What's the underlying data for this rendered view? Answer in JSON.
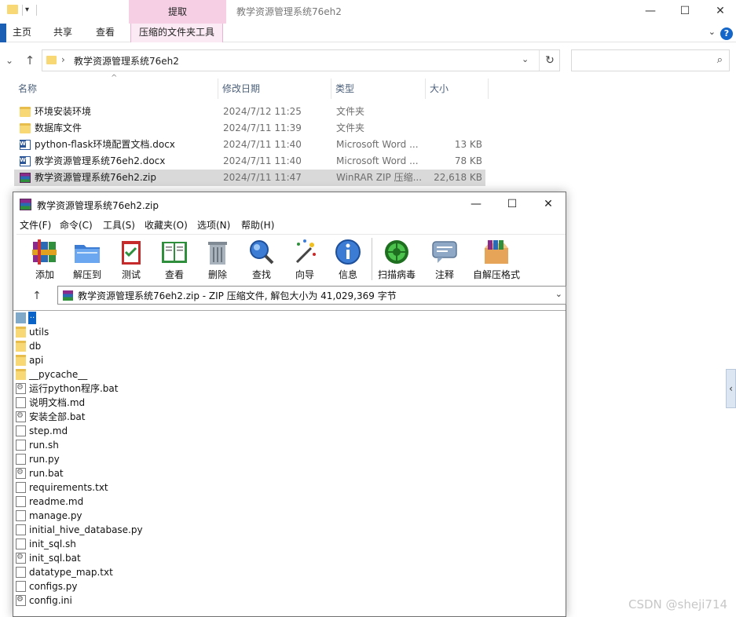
{
  "explorer": {
    "window_title": "教学资源管理系统76eh2",
    "context_tab": "提取",
    "ribbon_tabs": [
      "主页",
      "共享",
      "查看",
      "压缩的文件夹工具"
    ],
    "address": "教学资源管理系统76eh2",
    "columns": {
      "name": "名称",
      "date": "修改日期",
      "type": "类型",
      "size": "大小"
    },
    "files": [
      {
        "name": "环境安装环境",
        "date": "2024/7/12 11:25",
        "type": "文件夹",
        "size": "",
        "icon": "folder"
      },
      {
        "name": "数据库文件",
        "date": "2024/7/11 11:39",
        "type": "文件夹",
        "size": "",
        "icon": "folder"
      },
      {
        "name": "python-flask环境配置文档.docx",
        "date": "2024/7/11 11:40",
        "type": "Microsoft Word ...",
        "size": "13 KB",
        "icon": "word"
      },
      {
        "name": "教学资源管理系统76eh2.docx",
        "date": "2024/7/11 11:40",
        "type": "Microsoft Word ...",
        "size": "78 KB",
        "icon": "word"
      },
      {
        "name": "教学资源管理系统76eh2.zip",
        "date": "2024/7/11 11:47",
        "type": "WinRAR ZIP 压缩...",
        "size": "22,618 KB",
        "icon": "rar"
      }
    ]
  },
  "winrar": {
    "title": "教学资源管理系统76eh2.zip",
    "menu": [
      "文件(F)",
      "命令(C)",
      "工具(S)",
      "收藏夹(O)",
      "选项(N)",
      "帮助(H)"
    ],
    "toolbar": [
      "添加",
      "解压到",
      "测试",
      "查看",
      "删除",
      "查找",
      "向导",
      "信息",
      "扫描病毒",
      "注释",
      "自解压格式"
    ],
    "path_text": "教学资源管理系统76eh2.zip - ZIP 压缩文件, 解包大小为 41,029,369 字节",
    "up_entry": "..",
    "entries": [
      {
        "name": "utils",
        "icon": "folder"
      },
      {
        "name": "db",
        "icon": "folder"
      },
      {
        "name": "api",
        "icon": "folder"
      },
      {
        "name": "__pycache__",
        "icon": "folder"
      },
      {
        "name": "运行python程序.bat",
        "icon": "bat"
      },
      {
        "name": "说明文档.md",
        "icon": "file"
      },
      {
        "name": "安装全部.bat",
        "icon": "bat"
      },
      {
        "name": "step.md",
        "icon": "file"
      },
      {
        "name": "run.sh",
        "icon": "file"
      },
      {
        "name": "run.py",
        "icon": "file"
      },
      {
        "name": "run.bat",
        "icon": "bat"
      },
      {
        "name": "requirements.txt",
        "icon": "file"
      },
      {
        "name": "readme.md",
        "icon": "file"
      },
      {
        "name": "manage.py",
        "icon": "file"
      },
      {
        "name": "initial_hive_database.py",
        "icon": "file"
      },
      {
        "name": "init_sql.sh",
        "icon": "file"
      },
      {
        "name": "init_sql.bat",
        "icon": "bat"
      },
      {
        "name": "datatype_map.txt",
        "icon": "file"
      },
      {
        "name": "configs.py",
        "icon": "file"
      },
      {
        "name": "config.ini",
        "icon": "ini"
      }
    ]
  },
  "watermark": "CSDN @sheji714"
}
